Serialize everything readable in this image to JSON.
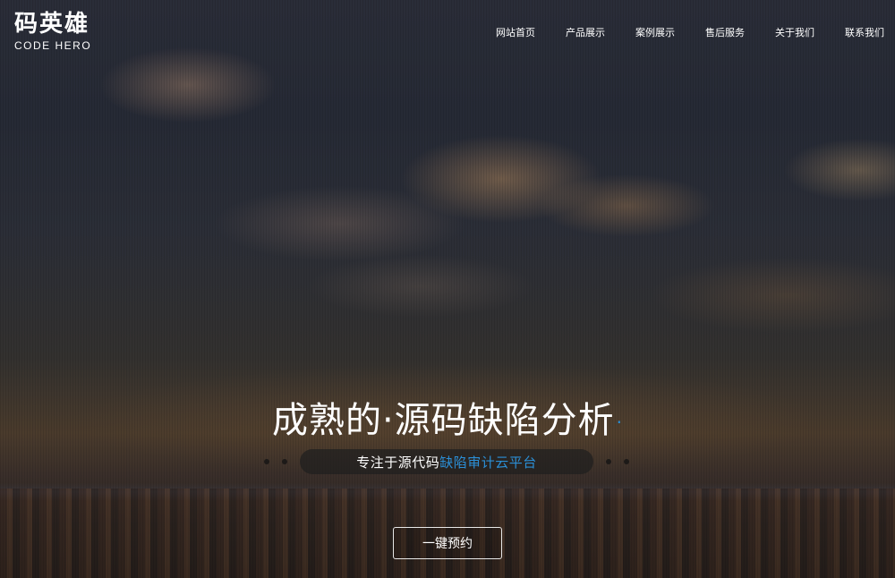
{
  "logo": {
    "cn": "码英雄",
    "en": "CODE HERO"
  },
  "nav": {
    "items": [
      "网站首页",
      "产品展示",
      "案例展示",
      "售后服务",
      "关于我们",
      "联系我们"
    ]
  },
  "hero": {
    "headline": "成熟的·源码缺陷分析",
    "headline_dot": "·",
    "subtitle_plain": "专注于源代码",
    "subtitle_accent": "缺陷审计云平台",
    "cta_label": "一键预约"
  },
  "colors": {
    "accent": "#2b8fd6",
    "text": "#ffffff"
  }
}
